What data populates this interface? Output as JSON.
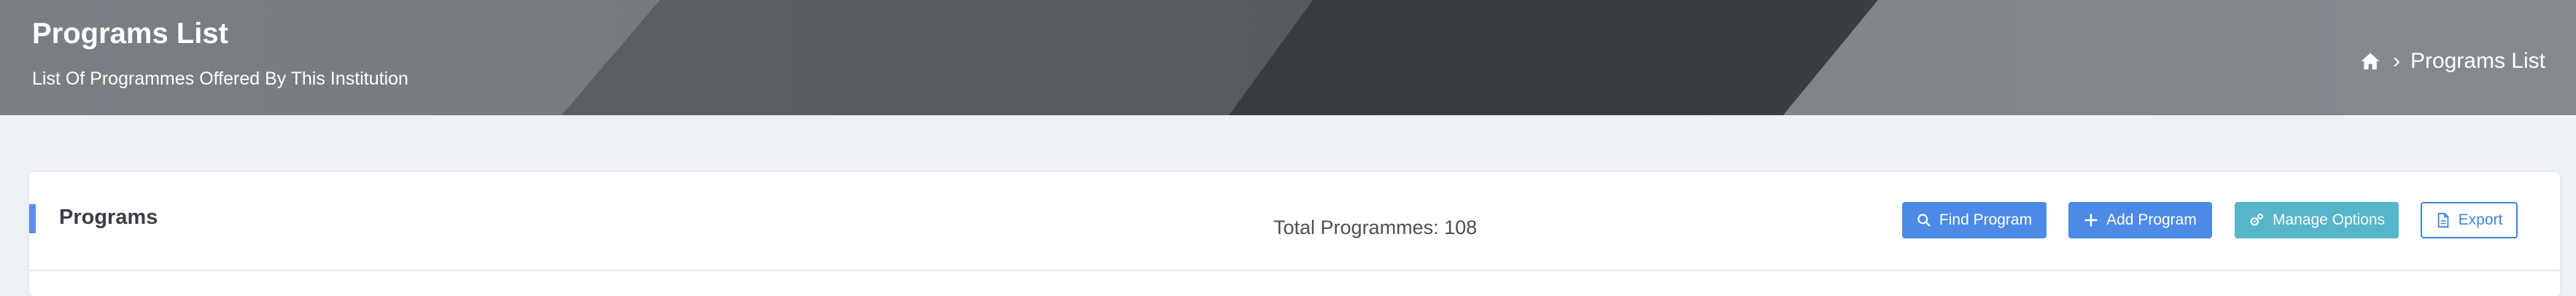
{
  "header": {
    "title": "Programs List",
    "subtitle": "List Of Programmes Offered By This Institution",
    "breadcrumb": {
      "home_icon": "home-icon",
      "separator": "›",
      "current": "Programs List"
    }
  },
  "card": {
    "title": "Programs",
    "total_label": "Total Programmes: 108",
    "buttons": {
      "find": {
        "label": "Find Program",
        "icon": "search-icon"
      },
      "add": {
        "label": "Add Program",
        "icon": "plus-icon"
      },
      "manage": {
        "label": "Manage Options",
        "icon": "gears-icon"
      },
      "export": {
        "label": "Export",
        "icon": "file-icon"
      }
    }
  },
  "colors": {
    "accent": "#5b8def",
    "primary_button": "#4d8ae6",
    "info_button": "#56b5c8",
    "export_outline": "#3f84d6",
    "page_background": "#eef2f5"
  }
}
